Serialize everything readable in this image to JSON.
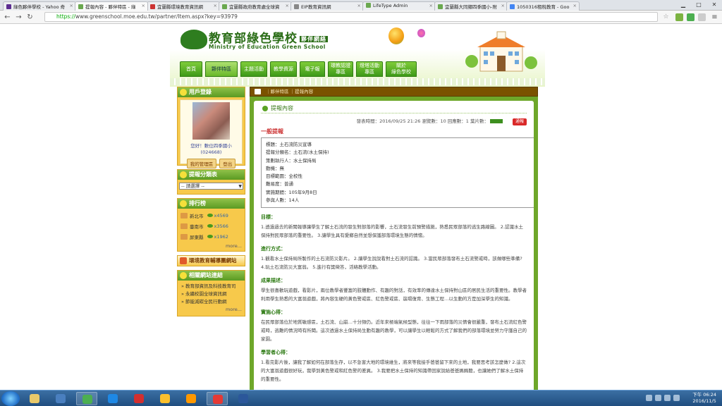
{
  "browser": {
    "tabs": [
      {
        "label": "綠色夥伴學校 - Yahoo 奇",
        "icon": "yahoo-icon",
        "color": "#5c2d91",
        "active": false
      },
      {
        "label": "提報內容 - 夥伴特區 - 綠",
        "icon": "page-icon",
        "color": "#6aa84f",
        "active": true
      },
      {
        "label": "宜蘭縣環境教育資訊網",
        "icon": "ftp-icon",
        "color": "#cc3333",
        "active": false
      },
      {
        "label": "宜蘭縣政府教育處全球資",
        "icon": "page-icon",
        "color": "#6aa84f",
        "active": false
      },
      {
        "label": "EIP教育資訊網",
        "icon": "page-icon",
        "color": "#888888",
        "active": false
      },
      {
        "label": "LifeType Admin",
        "icon": "page-icon",
        "color": "#6aa84f",
        "active": false
      },
      {
        "label": "宜蘭縣大同鄉四季國小-附",
        "icon": "page-icon",
        "color": "#6aa84f",
        "active": false
      },
      {
        "label": "1050316租稅教育 - Goo",
        "icon": "drive-icon",
        "color": "#4285f4",
        "active": false
      }
    ],
    "url_prefix": "https://",
    "url_rest": "www.greenschool.moe.edu.tw/partner/Item.aspx?key=93979"
  },
  "site": {
    "title": "教育部綠色學校",
    "title_suffix": "夥伴網絡",
    "subtitle": "Ministry of Education Green School",
    "nav": [
      {
        "label": "首頁",
        "active": false
      },
      {
        "label": "夥伴特區",
        "active": true
      },
      {
        "label": "主題活動",
        "active": false
      },
      {
        "label": "教學資源",
        "active": false
      },
      {
        "label": "電子報",
        "active": false
      },
      {
        "label": "環教認證\n專區",
        "active": false
      },
      {
        "label": "燈塔活動\n專區",
        "active": false
      },
      {
        "label": "關於\n綠色學校",
        "active": false
      }
    ]
  },
  "sidebar": {
    "login_title": "用戶登錄",
    "greeting": "您好！數位四季國小",
    "user_id": "(024668)",
    "my_admin": "我的管理區",
    "logout": "登出",
    "category_title": "提報分類表",
    "category_select": "-- 請選擇 --",
    "rank_title": "排行榜",
    "rank": [
      {
        "name": "新北市",
        "count": "x4569"
      },
      {
        "name": "臺南市",
        "count": "x3566"
      },
      {
        "name": "屏東縣",
        "count": "x1962"
      }
    ],
    "rank_more": "more...",
    "env_link": "環境教育輔導團網站",
    "links_title": "相關網站連結",
    "links": [
      "教育部資訊及科技教育司",
      "永續校園全球資訊網",
      "節能減碳全民行動網"
    ],
    "links_more": "more..."
  },
  "main": {
    "breadcrumb": [
      "夥伴特區",
      "提報內容"
    ],
    "panel_title": "提報內容",
    "meta": "發表時間：2016/09/25 21:26   瀏覽數：10   回應數：1   葉片數：",
    "report_btn": "通報",
    "section_title": "一般提報",
    "info": [
      "標題：土石流防災宣導",
      "提報分類名：土石流(水土保持)",
      "策劃執行人：水土保持局",
      "動機：無",
      "目標範圍：全校性",
      "難易度：普通",
      "實施期間：105年9月8日",
      "參與人數：14人"
    ],
    "sections": [
      {
        "heading": "目標：",
        "text": "1.透過過去的新聞報導讓學生了解土石流的發生對部落的影響，土石流發生前預警措施，熟悉民眾部落的逃生路線圖。 2.認識水土保持對民眾部落的重要性。 3.讓學生具有愛鄉自然並想保護部落環境生態的情懷。"
      },
      {
        "heading": "進行方式：",
        "text": "1.觀看水土保持局所製作的土石流防災影片。 2.讓學生說說看對土石流的認識。 3.當民眾部落發布土石流警戒時，該做哪些準備? 4.玩土石流防災大富翁。 5.進行有獎徵答，活絡教學活動。"
      },
      {
        "heading": "成果描述：",
        "text": "學生很喜歡玩遊戲，看影片，兩位教學者豐富的肢體動作、有趣的對話，有效率的傳達水土保持對山區的居民生活的重要性。教學者利用學生熟悉的大富翁遊戲，將內容生硬的黃色警戒區、紅色警戒區、崩塌復育、生態工程…以生動的方是加深學生的知識。"
      },
      {
        "heading": "實施心得：",
        "text": "在民眾部落位於地質敏感區，土石流、山崩…十分頻仍。近年來極端氣候型態，往往一下雨部落的災情會很嚴重，發布土石流紅色警戒時，逃難的情況時有所聞。這次透過水土保持局生動有趣的教學，可以讓學生以輕鬆的方式了解我們的部落環境並努力守護自己的家園。"
      },
      {
        "heading": "學習者心得：",
        "text": "1.看完影片後，讓我了解如何在部落生存，以不急害大地的環境維生，將來等我接手爸爸留下來的土地，我要思考該怎麼做? 2.這次的大富翁遊戲很好玩，我學到黃色警戒和紅色警的差異。 3.我要把水土保持的知識帶回家說給爸爸媽媽聽，也讓她們了解水土保持的重要性。"
      },
      {
        "heading": "補充：",
        "text": ""
      },
      {
        "heading": "上傳照片：",
        "text": ""
      }
    ]
  },
  "taskbar": {
    "apps": [
      "explorer-icon",
      "media-icon",
      "chrome-icon",
      "ie-icon",
      "opera-icon",
      "calendar-icon",
      "vlc-icon",
      "paint-icon",
      "word-icon"
    ],
    "time": "下午 06:24",
    "date": "2016/11/5"
  }
}
